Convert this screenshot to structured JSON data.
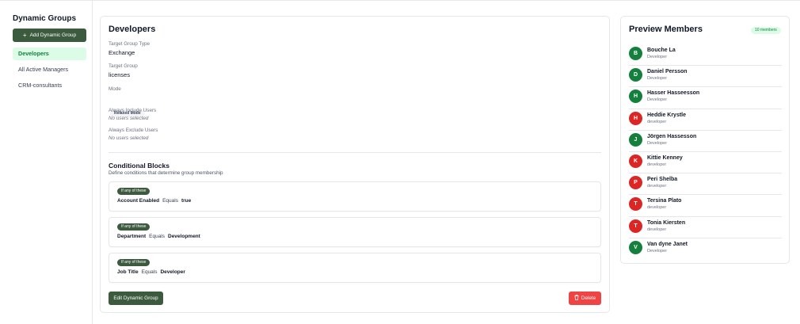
{
  "sidebar": {
    "title": "Dynamic Groups",
    "add_button": "Add Dynamic Group",
    "items": [
      {
        "label": "Developers",
        "active": true
      },
      {
        "label": "All Active Managers",
        "active": false
      },
      {
        "label": "CRM-consultants",
        "active": false
      }
    ]
  },
  "main": {
    "title": "Developers",
    "target_group_type_label": "Target Group Type",
    "target_group_type_value": "Exchange",
    "target_group_label": "Target Group",
    "target_group_value": "licenses",
    "mode_label": "Mode",
    "mode_value": "Relaxed Mode",
    "always_include_label": "Always Include Users",
    "always_include_value": "No users selected",
    "always_exclude_label": "Always Exclude Users",
    "always_exclude_value": "No users selected",
    "conditional_title": "Conditional Blocks",
    "conditional_desc": "Define conditions that determine group membership",
    "blocks": [
      {
        "badge": "If any of these",
        "field": "Account Enabled",
        "operator": "Equals",
        "value": "true"
      },
      {
        "badge": "If any of these",
        "field": "Department",
        "operator": "Equals",
        "value": "Development"
      },
      {
        "badge": "If any of these",
        "field": "Job Title",
        "operator": "Equals",
        "value": "Developer"
      }
    ],
    "edit_button": "Edit Dynamic Group",
    "delete_button": "Delete"
  },
  "preview": {
    "title": "Preview Members",
    "count": "10 members",
    "members": [
      {
        "initial": "B",
        "name": "Bouche La",
        "role": "Developer",
        "color": "#15803d"
      },
      {
        "initial": "D",
        "name": "Daniel Persson",
        "role": "Developer",
        "color": "#15803d"
      },
      {
        "initial": "H",
        "name": "Hasser Hasseesson",
        "role": "Developer",
        "color": "#15803d"
      },
      {
        "initial": "H",
        "name": "Heddie Krystle",
        "role": "developer",
        "color": "#dc2626"
      },
      {
        "initial": "J",
        "name": "Jörgen Hassesson",
        "role": "Developer",
        "color": "#15803d"
      },
      {
        "initial": "K",
        "name": "Kittie Kenney",
        "role": "developer",
        "color": "#dc2626"
      },
      {
        "initial": "P",
        "name": "Peri Shelba",
        "role": "developer",
        "color": "#dc2626"
      },
      {
        "initial": "T",
        "name": "Tersina Plato",
        "role": "developer",
        "color": "#dc2626"
      },
      {
        "initial": "T",
        "name": "Tonia Kiersten",
        "role": "developer",
        "color": "#dc2626"
      },
      {
        "initial": "V",
        "name": "Van dyne Janet",
        "role": "Developer",
        "color": "#15803d"
      }
    ]
  }
}
